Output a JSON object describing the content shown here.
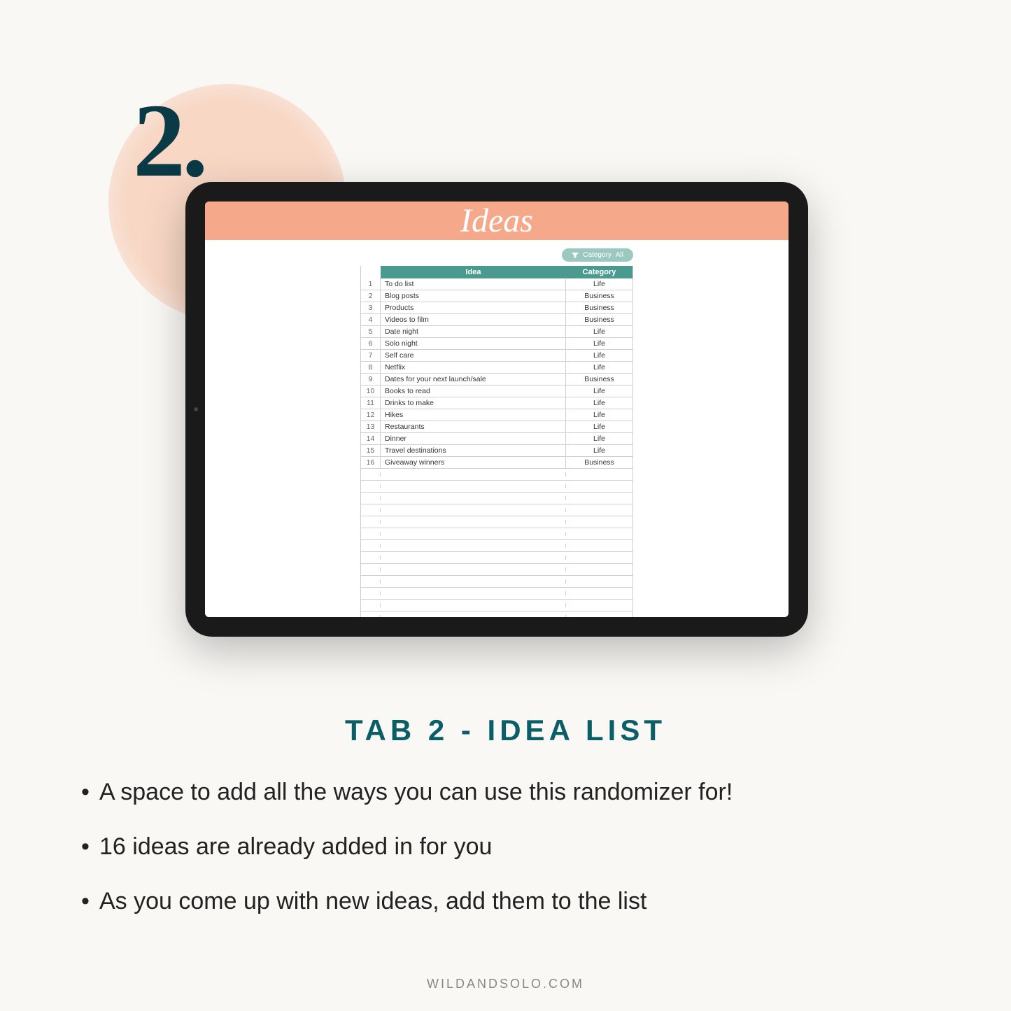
{
  "step_number": "2.",
  "app": {
    "title": "Ideas",
    "filter": {
      "label": "Category",
      "value": "All"
    },
    "columns": {
      "idea": "Idea",
      "category": "Category"
    },
    "rows": [
      {
        "n": "1",
        "idea": "To do list",
        "cat": "Life"
      },
      {
        "n": "2",
        "idea": "Blog posts",
        "cat": "Business"
      },
      {
        "n": "3",
        "idea": "Products",
        "cat": "Business"
      },
      {
        "n": "4",
        "idea": "Videos to film",
        "cat": "Business"
      },
      {
        "n": "5",
        "idea": "Date night",
        "cat": "Life"
      },
      {
        "n": "6",
        "idea": "Solo night",
        "cat": "Life"
      },
      {
        "n": "7",
        "idea": "Self care",
        "cat": "Life"
      },
      {
        "n": "8",
        "idea": "Netflix",
        "cat": "Life"
      },
      {
        "n": "9",
        "idea": "Dates for your next launch/sale",
        "cat": "Business"
      },
      {
        "n": "10",
        "idea": "Books to read",
        "cat": "Life"
      },
      {
        "n": "11",
        "idea": "Drinks to make",
        "cat": "Life"
      },
      {
        "n": "12",
        "idea": "Hikes",
        "cat": "Life"
      },
      {
        "n": "13",
        "idea": "Restaurants",
        "cat": "Life"
      },
      {
        "n": "14",
        "idea": "Dinner",
        "cat": "Life"
      },
      {
        "n": "15",
        "idea": "Travel destinations",
        "cat": "Life"
      },
      {
        "n": "16",
        "idea": "Giveaway winners",
        "cat": "Business"
      }
    ],
    "empty_rows": 14
  },
  "section_title": "TAB 2 - IDEA LIST",
  "bullets": [
    "A space to add all the ways you can use this randomizer for!",
    "16 ideas are already added in for you",
    "As you come up with new ideas, add them to the list"
  ],
  "footer": "WILDANDSOLO.COM"
}
